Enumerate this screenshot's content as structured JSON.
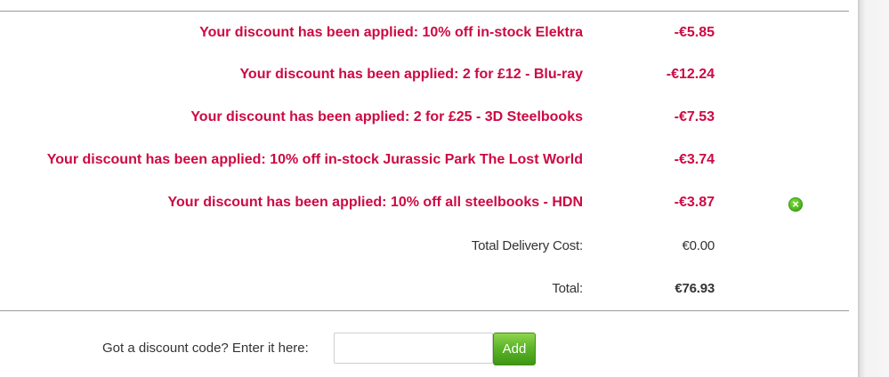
{
  "basket": {
    "discounts": [
      {
        "text": "Your discount has been applied: 10% off in-stock Elektra",
        "amount": "-€5.85"
      },
      {
        "text": "Your discount has been applied: 2 for £12 - Blu-ray",
        "amount": "-€12.24"
      },
      {
        "text": "Your discount has been applied: 2 for £25 - 3D Steelbooks",
        "amount": "-€7.53"
      },
      {
        "text": "Your discount has been applied: 10% off in-stock Jurassic Park The Lost World",
        "amount": "-€3.74"
      },
      {
        "text": "Your discount has been applied: 10% off all steelbooks - HDN",
        "amount": "-€3.87"
      }
    ],
    "delivery": {
      "label": "Total Delivery Cost:",
      "value": "€0.00"
    },
    "total": {
      "label": "Total:",
      "value": "€76.93"
    },
    "remove_icon": "close-circle-icon"
  },
  "discount_code": {
    "label": "Got a discount code? Enter it here:",
    "value": "",
    "placeholder": "",
    "button_label": "Add"
  },
  "colors": {
    "discount_text": "#cc0a44",
    "button_green": "#5cb62a"
  }
}
